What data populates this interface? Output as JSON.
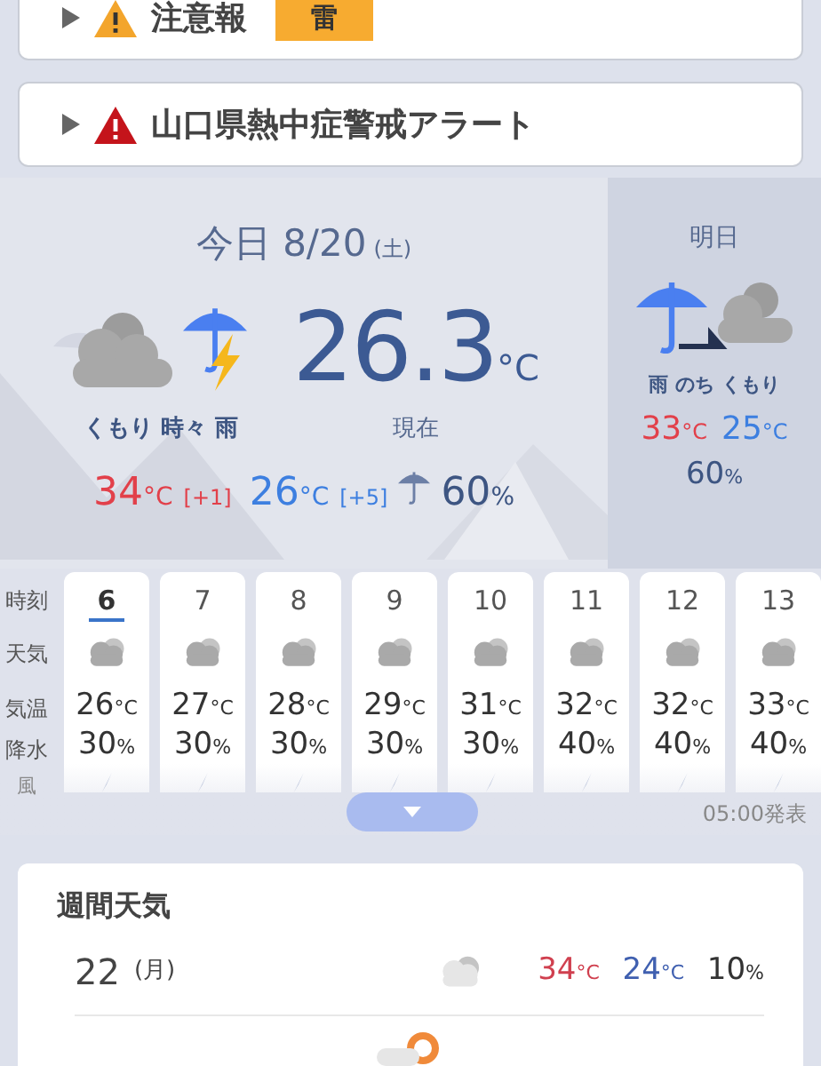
{
  "alerts": [
    {
      "kind": "advisory",
      "title": "注意報",
      "tag": "雷",
      "expanded": false
    },
    {
      "kind": "warning",
      "title": "山口県熱中症警戒アラート",
      "expanded": false
    }
  ],
  "today": {
    "title": "今日 8/20",
    "weekday": "(土)",
    "condition": "くもり 時々 雨",
    "current": {
      "value": "26.3",
      "unit": "°C",
      "label": "現在"
    },
    "high": {
      "value": "34",
      "unit": "°C",
      "diff": "[+1]"
    },
    "low": {
      "value": "26",
      "unit": "°C",
      "diff": "[+5]"
    },
    "rain": {
      "value": "60",
      "unit": "%"
    }
  },
  "tomorrow": {
    "title": "明日",
    "condition": "雨 のち くもり",
    "high": {
      "value": "33",
      "unit": "°C"
    },
    "low": {
      "value": "25",
      "unit": "°C"
    },
    "rain": {
      "value": "60",
      "unit": "%"
    }
  },
  "hourly": {
    "labels": [
      "時刻",
      "天気",
      "気温",
      "降水",
      "風"
    ],
    "hours": [
      {
        "hour": "6",
        "temp": "26",
        "temp_unit": "°C",
        "rain": "30",
        "rain_unit": "%",
        "selected": true
      },
      {
        "hour": "7",
        "temp": "27",
        "temp_unit": "°C",
        "rain": "30",
        "rain_unit": "%",
        "selected": false
      },
      {
        "hour": "8",
        "temp": "28",
        "temp_unit": "°C",
        "rain": "30",
        "rain_unit": "%",
        "selected": false
      },
      {
        "hour": "9",
        "temp": "29",
        "temp_unit": "°C",
        "rain": "30",
        "rain_unit": "%",
        "selected": false
      },
      {
        "hour": "10",
        "temp": "31",
        "temp_unit": "°C",
        "rain": "30",
        "rain_unit": "%",
        "selected": false
      },
      {
        "hour": "11",
        "temp": "32",
        "temp_unit": "°C",
        "rain": "40",
        "rain_unit": "%",
        "selected": false
      },
      {
        "hour": "12",
        "temp": "32",
        "temp_unit": "°C",
        "rain": "40",
        "rain_unit": "%",
        "selected": false
      },
      {
        "hour": "13",
        "temp": "33",
        "temp_unit": "°C",
        "rain": "40",
        "rain_unit": "%",
        "selected": false
      }
    ],
    "issued": "05:00発表"
  },
  "weekly": {
    "title": "週間天気",
    "days": [
      {
        "day": "22",
        "weekday": "(月)",
        "high": "34",
        "high_unit": "°C",
        "low": "24",
        "low_unit": "°C",
        "rain": "10",
        "rain_unit": "%"
      }
    ]
  }
}
